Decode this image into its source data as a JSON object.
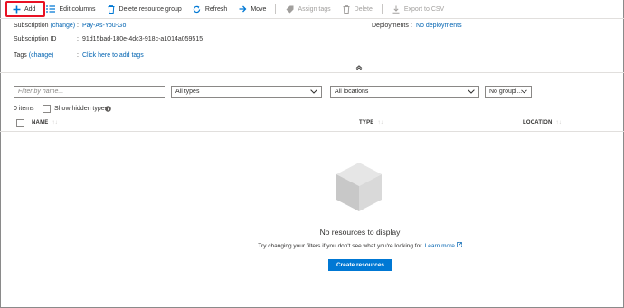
{
  "toolbar": {
    "add": "Add",
    "edit_columns": "Edit columns",
    "delete_group": "Delete resource group",
    "refresh": "Refresh",
    "move": "Move",
    "assign_tags": "Assign tags",
    "delete": "Delete",
    "export_csv": "Export to CSV"
  },
  "essentials": {
    "subscription_label": "Subscription",
    "subscription_change": "(change)",
    "subscription_value": "Pay-As-You-Go",
    "subscription_id_label": "Subscription ID",
    "subscription_id_value": "91d15bad-180e-4dc3-918c-a1014a059515",
    "tags_label": "Tags",
    "tags_change": "(change)",
    "tags_value": "Click here to add tags",
    "deployments_label": "Deployments",
    "deployments_value": "No deployments",
    "separator": ":",
    "collapse_glyph": "^"
  },
  "filters": {
    "name_placeholder": "Filter by name...",
    "types_value": "All types",
    "locations_value": "All locations",
    "grouping_value": "No groupi..."
  },
  "list": {
    "item_count": "0 items",
    "show_hidden_label": "Show hidden types",
    "col_name": "NAME",
    "col_type": "TYPE",
    "col_location": "LOCATION"
  },
  "empty_state": {
    "title": "No resources to display",
    "subtitle": "Try changing your filters if you don't see what you're looking for.",
    "learn_more": "Learn more",
    "create_button": "Create resources"
  },
  "colors": {
    "accent": "#0078d4",
    "link": "#0063b1",
    "highlight": "#e81123"
  }
}
